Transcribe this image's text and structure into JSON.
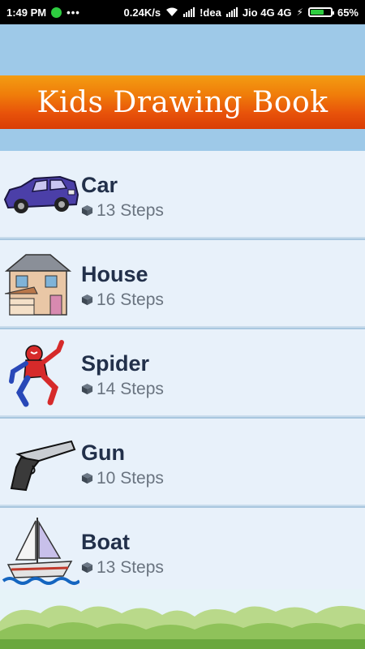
{
  "status_bar": {
    "time": "1:49 PM",
    "speed": "0.24K/s",
    "carrier1": "!dea",
    "carrier2": "Jio 4G 4G",
    "battery": "65%",
    "battery_level": 0.65,
    "icons": [
      "whatsapp-icon",
      "more-dots-icon",
      "wifi-icon",
      "signal-icon",
      "charging-icon",
      "battery-icon"
    ]
  },
  "header": {
    "title": "Kids Drawing Book"
  },
  "items": [
    {
      "name": "Car",
      "steps": "13 Steps",
      "icon": "car-thumbnail"
    },
    {
      "name": "House",
      "steps": "16 Steps",
      "icon": "house-thumbnail"
    },
    {
      "name": "Spider",
      "steps": "14 Steps",
      "icon": "spider-thumbnail"
    },
    {
      "name": "Gun",
      "steps": "10 Steps",
      "icon": "gun-thumbnail"
    },
    {
      "name": "Boat",
      "steps": "13 Steps",
      "icon": "boat-thumbnail"
    }
  ],
  "colors": {
    "title_bar": "#e8530a",
    "sky": "#9ec9e8",
    "item_bg": "#e8f1fa",
    "item_text": "#22304a"
  }
}
